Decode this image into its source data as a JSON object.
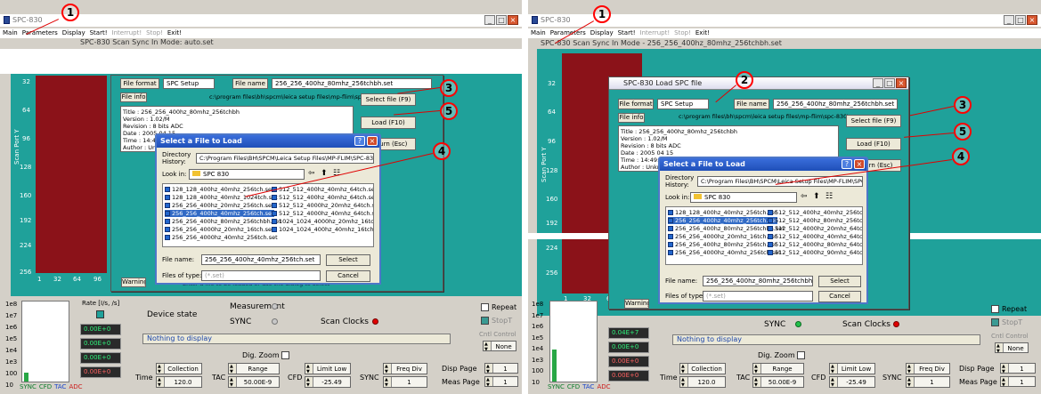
{
  "left": {
    "window_title": "SPC-830",
    "menu": [
      "Main",
      "Parameters",
      "Display",
      "Start!",
      "Interrupt!",
      "Stop!",
      "Exit!"
    ],
    "subtitle": "SPC-830   Scan Sync In Mode: auto.set",
    "y_axis_title": "Scan Port Y",
    "y_ticks": [
      "32",
      "64",
      "96",
      "128",
      "160",
      "192",
      "224",
      "256"
    ],
    "x_ticks": [
      "1",
      "32",
      "64",
      "96"
    ],
    "warning_label": "Warning",
    "spc_dialog": {
      "file_format_label": "File format",
      "file_format_value": "SPC Setup",
      "file_name_label": "File name",
      "file_name_value": "256_256_400hz_80mhz_256tchbh.set",
      "file_info_label": "File info",
      "path": "c:\\program files\\bh\\spcm\\leica setup files\\mp-flim\\spc-830\\",
      "select_file_btn": "Select file (F9)",
      "load_btn": "Load (F10)",
      "return_btn": "Return (Esc)",
      "info_lines": [
        "Title : 256_256_400hz_80mhz_256tchbh",
        "Version : 1.02/M",
        "Revision : 8 bits ADC",
        "Date : 2005 04 15",
        "Time : 14:49:41",
        "Author : Unknown",
        "Company : Unknown",
        "Contents : Setup"
      ],
      "hint": "Enter a file to be loaded or use the dialog to select"
    },
    "file_dialog": {
      "title": "Select a File to Load",
      "directory_history_label": "Directory History:",
      "directory_value": "C:\\Program Files\\BH\\SPCM\\Leica Setup Files\\MP-FLIM\\SPC-830",
      "look_in_label": "Look in:",
      "look_in_value": "SPC 830",
      "files": [
        "128_128_400hz_40mhz_256tch.set",
        "128_128_400hz_40mhz_1024tch.set",
        "256_256_400hz_20mhz_256tch.set",
        "256_256_400hz_40mhz_256tch.set",
        "256_256_400hz_80mhz_256tchbh.set",
        "256_256_4000hz_20mhz_16tch.set",
        "256_256_4000hz_40mhz_256tch.set",
        "512_512_400hz_40mhz_64tch.set",
        "512_512_400hz_40mhz_64tch.set",
        "512_512_4000hz_20mhz_64tch.set",
        "512_512_4000hz_40mhz_64tch.set",
        "1024_1024_4000hz_20mhz_16tch.set",
        "1024_1024_400hz_40mhz_16tch.set"
      ],
      "file_name_label": "File name:",
      "file_name_value": "256_256_400hz_40mhz_256tch.set",
      "files_of_type_label": "Files of type:",
      "files_of_type_value": "(*.set)",
      "select_btn": "Select",
      "cancel_btn": "Cancel"
    },
    "markers": {
      "one": "1",
      "three": "3",
      "four": "4",
      "five": "5"
    }
  },
  "right": {
    "window_title": "SPC-830",
    "menu": [
      "Main",
      "Parameters",
      "Display",
      "Start!",
      "Interrupt!",
      "Stop!",
      "Exit!"
    ],
    "subtitle": "SPC-830   Scan Sync In Mode - 256_256_400hz_80mhz_256tchbh.set",
    "y_axis_title": "Scan Port Y",
    "y_ticks": [
      "32",
      "64",
      "96",
      "128",
      "160",
      "192",
      "224",
      "256"
    ],
    "x_ticks": [
      "1",
      "32",
      "64"
    ],
    "warning_label": "Warning",
    "spc_dialog": {
      "title": "SPC-830 Load SPC file",
      "file_format_label": "File format",
      "file_format_value": "SPC Setup",
      "file_name_label": "File name",
      "file_name_value": "256_256_400hz_80mhz_256tchbh.set",
      "file_info_label": "File info",
      "path": "c:\\program files\\bh\\spcm\\leica setup files\\mp-flim\\spc-830\\",
      "select_file_btn": "Select file (F9)",
      "load_btn": "Load (F10)",
      "return_btn": "Return (Esc)",
      "info_lines": [
        "Title : 256_256_400hz_80mhz_256tchbh",
        "Version : 1.02/M",
        "Revision : 8 bits ADC",
        "Date : 2005 04 15",
        "Time : 14:49:41",
        "Author : Unknown",
        "Company : Unknown",
        "Contents : Setup"
      ]
    },
    "file_dialog": {
      "title": "Select a File to Load",
      "directory_history_label": "Directory History:",
      "directory_value": "C:\\Program Files\\BH\\SPCM\\Leica Setup Files\\MP-FLIM\\SPC-830",
      "look_in_label": "Look in:",
      "look_in_value": "SPC 830",
      "files": [
        "128_128_400hz_40mhz_256tch.set",
        "256_256_400hz_40mhz_256tch.set",
        "256_256_400hz_80mhz_256tchbh.set",
        "256_256_4000hz_20mhz_16tch.set",
        "256_256_400hz_80mhz_256tch.set",
        "256_256_4000hz_40mhz_256tch.set",
        "512_512_400hz_40mhz_256tch.set",
        "512_512_400hz_80mhz_256tch.set",
        "512_512_4000hz_20mhz_64tch.set",
        "512_512_4000hz_40mhz_64tch.set",
        "512_512_4000hz_80mhz_64tch.set",
        "512_512_4000hz_90mhz_64tch.set"
      ],
      "file_name_label": "File name:",
      "file_name_value": "256_256_400hz_80mhz_256tchbh.set",
      "files_of_type_label": "Files of type:",
      "files_of_type_value": "(*.set)",
      "select_btn": "Select",
      "cancel_btn": "Cancel"
    },
    "markers": {
      "one": "1",
      "two": "2",
      "three": "3",
      "four": "4",
      "five": "5"
    }
  },
  "panel": {
    "rate_title": "Rate [I/s, /s]",
    "scale": [
      "1e8",
      "1e7",
      "1e6",
      "1e5",
      "1e4",
      "1e3",
      "100",
      "10"
    ],
    "gauge_legend": [
      "SYNC",
      "CFD",
      "TAC",
      "ADC"
    ],
    "rate_values_left": [
      "0.00E+0",
      "0.00E+0",
      "0.00E+0",
      "0.00E+0"
    ],
    "rate_values_right": [
      "0.04E+7",
      "0.00E+0",
      "0.00E+0",
      "0.00E+0"
    ],
    "device_state": "Device state",
    "measurement": "Measurement",
    "sync": "SYNC",
    "scan_clocks": "Scan Clocks",
    "nothing_to_display": "Nothing to display",
    "repeat": "Repeat",
    "stopt": "StopT",
    "cont_control": "Cntl Control",
    "cont_value": "None",
    "dig_zoom": "Dig. Zoom",
    "time_label": "Time",
    "collection_label": "Collection",
    "collection_value": "120.0",
    "tac_label": "TAC",
    "range_label": "Range",
    "range_value": "50.00E-9",
    "cfd_label": "CFD",
    "limit_low_label": "Limit Low",
    "limit_low_value": "-25.49",
    "sync_label": "SYNC",
    "freq_div_label": "Freq Div",
    "freq_div_value": "1",
    "disp_page_label": "Disp Page",
    "disp_page_value": "1",
    "meas_page_label": "Meas Page",
    "meas_page_value": "1"
  }
}
